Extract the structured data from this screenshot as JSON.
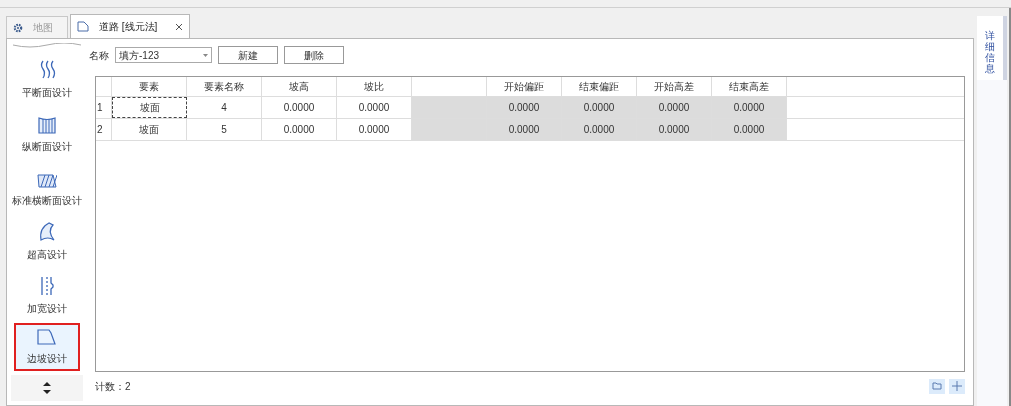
{
  "tabs": [
    {
      "label": "地图",
      "selected": false,
      "closable": false
    },
    {
      "label": "道路 [线元法]",
      "selected": true,
      "closable": true
    }
  ],
  "sidebar": {
    "items": [
      {
        "label": "平断面设计",
        "selected": false
      },
      {
        "label": "纵断面设计",
        "selected": false
      },
      {
        "label": "标准横断面设计",
        "selected": false
      },
      {
        "label": "超高设计",
        "selected": false
      },
      {
        "label": "加宽设计",
        "selected": false
      },
      {
        "label": "边坡设计",
        "selected": true
      }
    ]
  },
  "toolbar": {
    "name_label": "名称",
    "name_value": "填方-123",
    "buttons": [
      "新建",
      "删除"
    ]
  },
  "table": {
    "columns": [
      "要素",
      "要素名称",
      "坡高",
      "坡比",
      null,
      "开始偏距",
      "结束偏距",
      "开始高差",
      "结束高差"
    ],
    "rows": [
      {
        "number": "1",
        "cells": [
          {
            "text": "坡面",
            "readonly": false,
            "focused": true
          },
          {
            "text": "4",
            "readonly": false,
            "focused": false
          },
          {
            "text": "0.0000",
            "readonly": false,
            "focused": false
          },
          {
            "text": "0.0000",
            "readonly": false,
            "focused": false
          },
          {
            "readonly": true,
            "focused": false
          },
          {
            "text": "0.0000",
            "readonly": true,
            "focused": false
          },
          {
            "text": "0.0000",
            "readonly": true,
            "focused": false
          },
          {
            "text": "0.0000",
            "readonly": true,
            "focused": false
          },
          {
            "text": "0.0000",
            "readonly": true,
            "focused": false
          }
        ]
      },
      {
        "number": "2",
        "cells": [
          {
            "text": "坡面",
            "readonly": false,
            "focused": false
          },
          {
            "text": "5",
            "readonly": false,
            "focused": false
          },
          {
            "text": "0.0000",
            "readonly": false,
            "focused": false
          },
          {
            "text": "0.0000",
            "readonly": false,
            "focused": false
          },
          {
            "readonly": true,
            "focused": false
          },
          {
            "text": "0.0000",
            "readonly": true,
            "focused": false
          },
          {
            "text": "0.0000",
            "readonly": true,
            "focused": false
          },
          {
            "text": "0.0000",
            "readonly": true,
            "focused": false
          },
          {
            "text": "0.0000",
            "readonly": true,
            "focused": false
          }
        ]
      }
    ]
  },
  "status_bar": {
    "count": "计数：2"
  },
  "side_panel": {
    "tab": "详细信息"
  }
}
